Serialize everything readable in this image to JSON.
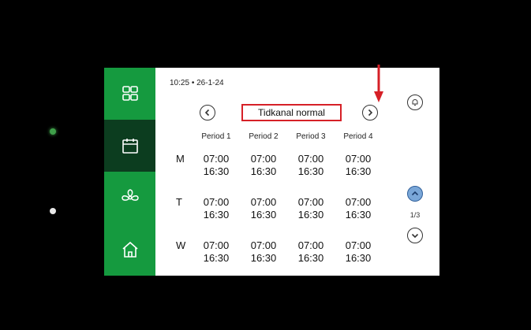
{
  "status": {
    "time": "10:25",
    "separator": "•",
    "date": "26-1-24"
  },
  "schedule": {
    "title": "Tidkanal normal",
    "periods": [
      "Period 1",
      "Period 2",
      "Period 3",
      "Period 4"
    ],
    "rows": [
      {
        "day": "M",
        "cells": [
          [
            "07:00",
            "16:30"
          ],
          [
            "07:00",
            "16:30"
          ],
          [
            "07:00",
            "16:30"
          ],
          [
            "07:00",
            "16:30"
          ]
        ]
      },
      {
        "day": "T",
        "cells": [
          [
            "07:00",
            "16:30"
          ],
          [
            "07:00",
            "16:30"
          ],
          [
            "07:00",
            "16:30"
          ],
          [
            "07:00",
            "16:30"
          ]
        ]
      },
      {
        "day": "W",
        "cells": [
          [
            "07:00",
            "16:30"
          ],
          [
            "07:00",
            "16:30"
          ],
          [
            "07:00",
            "16:30"
          ],
          [
            "07:00",
            "16:30"
          ]
        ]
      }
    ]
  },
  "pagination": {
    "indicator": "1/3"
  },
  "sidebar": {
    "items": [
      {
        "name": "dashboard",
        "icon": "grid-icon",
        "active": false
      },
      {
        "name": "schedule",
        "icon": "calendar-icon",
        "active": true
      },
      {
        "name": "fan",
        "icon": "fan-icon",
        "active": false
      },
      {
        "name": "home",
        "icon": "home-icon",
        "active": false
      }
    ]
  },
  "colors": {
    "sidebar": "#159a3f",
    "sidebar_active": "#0c3d1f",
    "highlight": "#d62027",
    "scroll_up_active": "#7aa7d8"
  }
}
